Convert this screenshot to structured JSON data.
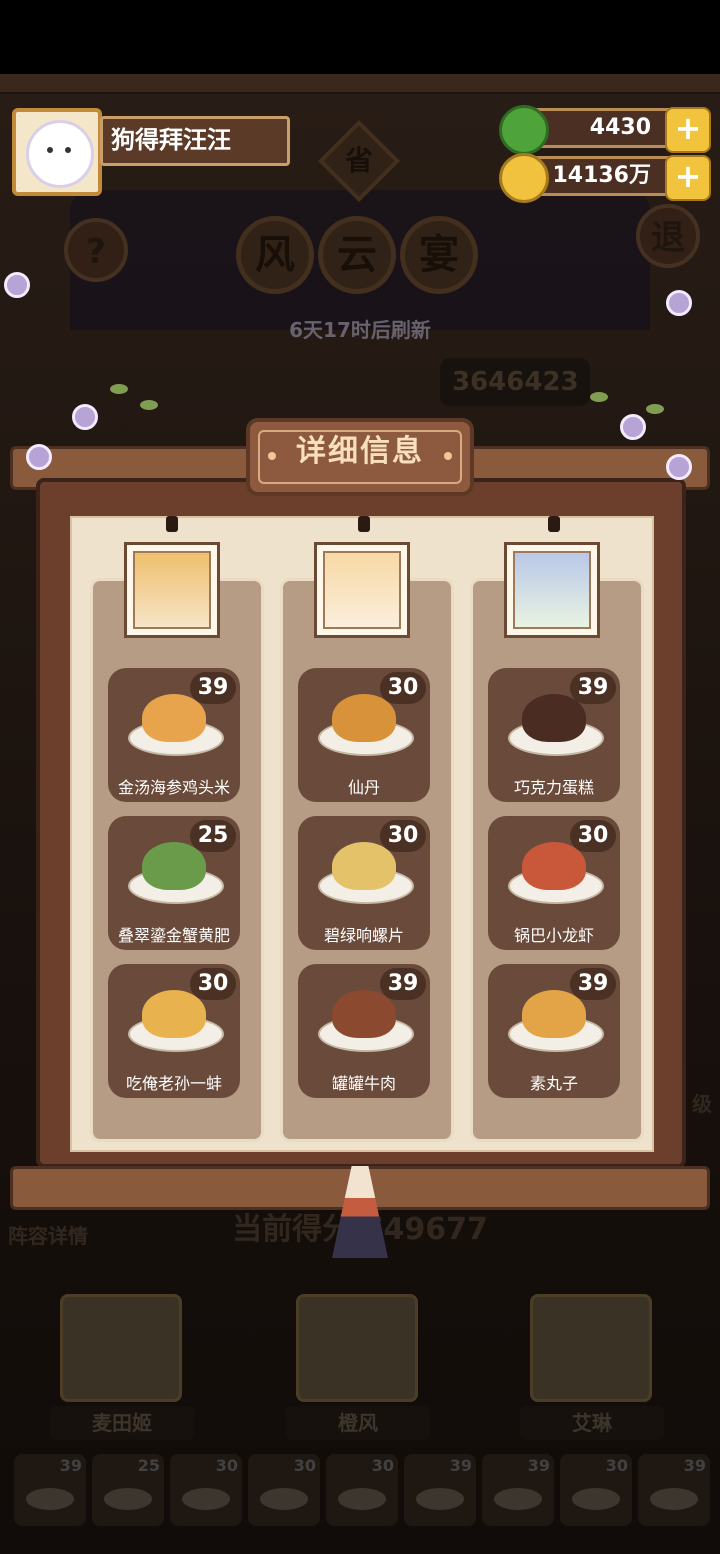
{
  "player": {
    "name": "狗得拜汪汪"
  },
  "currency": [
    {
      "icon": "green-apple-icon",
      "value": "4430"
    },
    {
      "icon": "gold-coin-icon",
      "value": "14136万"
    }
  ],
  "header": {
    "help": "?",
    "exit": "退",
    "badge": "省",
    "title_chars": [
      "风",
      "云",
      "宴"
    ],
    "refresh": "6天17时后刷新",
    "score_top": "3646423",
    "side_badge": "级"
  },
  "modal": {
    "title": "详细信息",
    "columns": [
      {
        "dishes": [
          {
            "name": "金汤海参鸡头米",
            "count": "39",
            "color": "#e8a34d"
          },
          {
            "name": "叠翠鎏金蟹黄肥",
            "count": "25",
            "color": "#6a9b4a"
          },
          {
            "name": "吃俺老孙一蚌",
            "count": "30",
            "color": "#e8b24e"
          }
        ]
      },
      {
        "dishes": [
          {
            "name": "仙丹",
            "count": "30",
            "color": "#d7923a"
          },
          {
            "name": "碧绿响螺片",
            "count": "30",
            "color": "#e4c26a"
          },
          {
            "name": "罐罐牛肉",
            "count": "39",
            "color": "#8b4a2f"
          }
        ]
      },
      {
        "dishes": [
          {
            "name": "巧克力蛋糕",
            "count": "39",
            "color": "#4a2c22"
          },
          {
            "name": "锅巴小龙虾",
            "count": "30",
            "color": "#c9573a"
          },
          {
            "name": "素丸子",
            "count": "39",
            "color": "#e3a447"
          }
        ]
      }
    ]
  },
  "bottom": {
    "lineup": "阵容详情",
    "score_label": "当前得分",
    "score_value": "749677",
    "chefs": [
      "麦田姬",
      "橙风",
      "艾琳"
    ],
    "mini_counts": [
      "39",
      "25",
      "30",
      "30",
      "30",
      "39",
      "39",
      "30",
      "39"
    ]
  }
}
